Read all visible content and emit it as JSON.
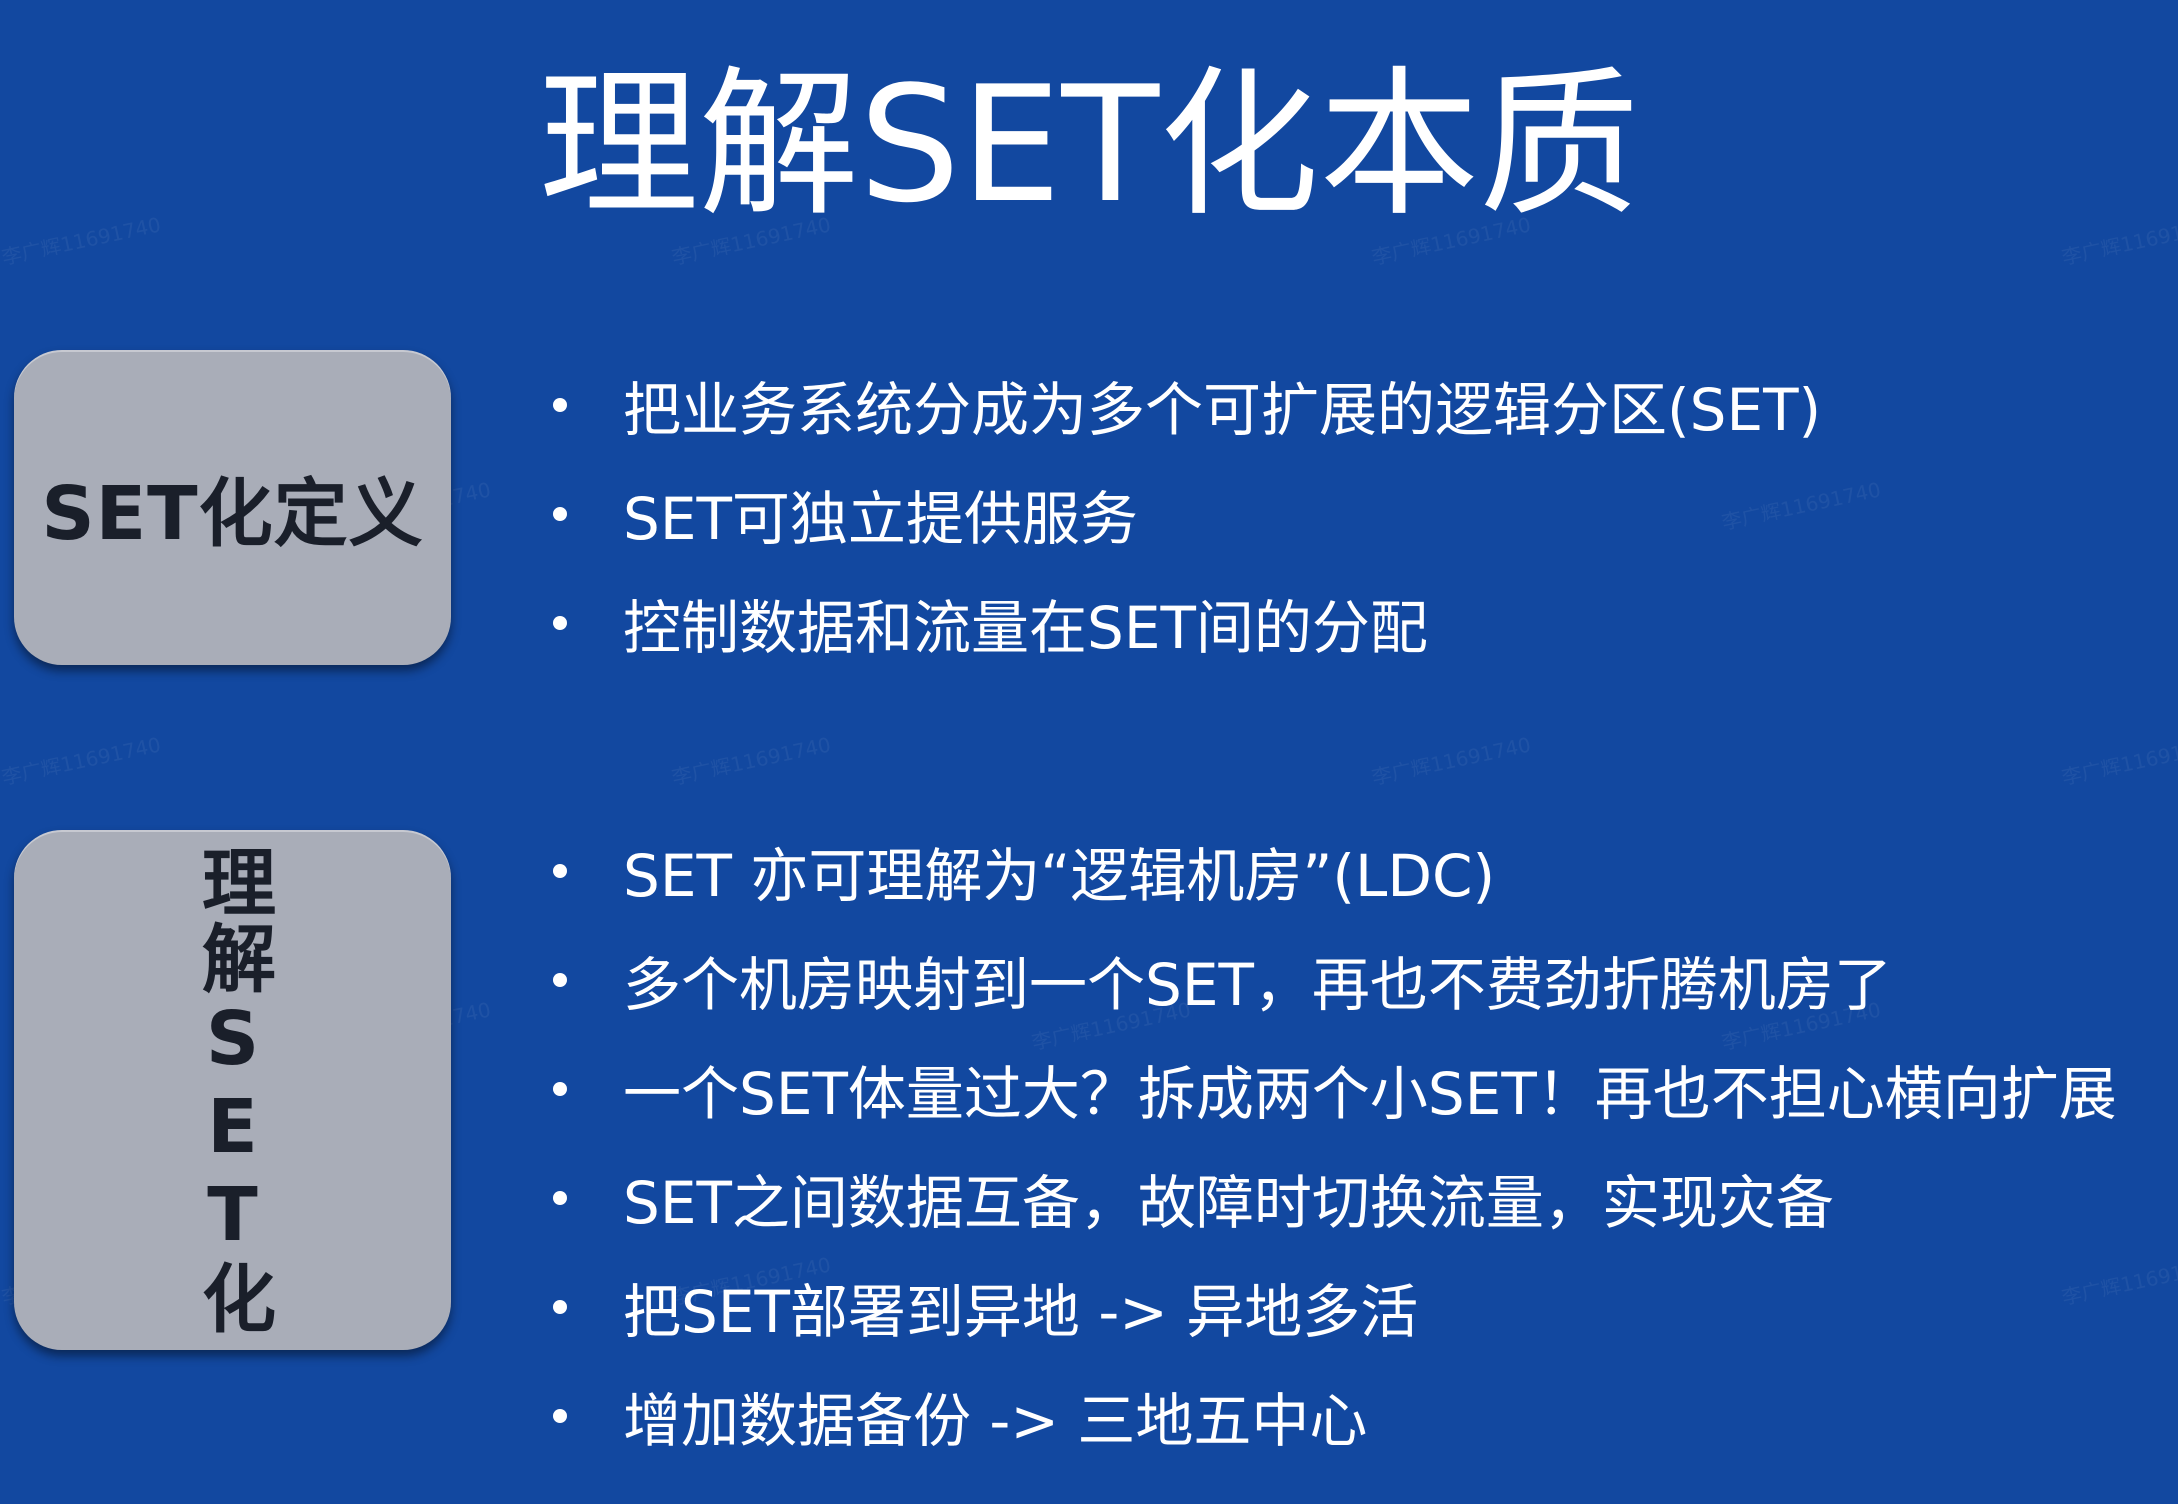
{
  "slide": {
    "background_color": "#1248a0",
    "title": "理解SET化本质"
  },
  "definition": {
    "label": "SET化定义",
    "box_color": "#a9adb8",
    "bullets": [
      "把业务系统分成为多个可扩展的逻辑分区(SET)",
      "SET可独立提供服务",
      "控制数据和流量在SET间的分配"
    ]
  },
  "understanding": {
    "label": "理解SET化",
    "box_color": "#a9adb8",
    "bullets": [
      "SET 亦可理解为“逻辑机房”(LDC)",
      "多个机房映射到一个SET，再也不费劲折腾机房了",
      "一个SET体量过大？拆成两个小SET！再也不担心横向扩展",
      "SET之间数据互备，故障时切换流量，实现灾备",
      "把SET部署到异地 -> 异地多活",
      "增加数据备份 -> 三地五中心"
    ]
  }
}
